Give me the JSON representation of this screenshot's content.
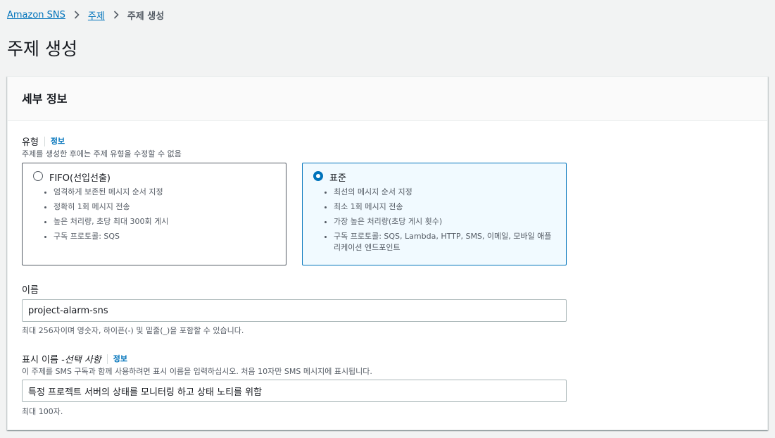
{
  "breadcrumb": {
    "items": [
      {
        "label": "Amazon SNS"
      },
      {
        "label": "주제"
      },
      {
        "label": "주제 생성"
      }
    ]
  },
  "page": {
    "title": "주제 생성"
  },
  "details_panel": {
    "title": "세부 정보",
    "type_field": {
      "label": "유형",
      "info": "정보",
      "description": "주제를 생성한 후에는 주제 유형을 수정할 수 없음",
      "options": [
        {
          "title": "FIFO(선입선출)",
          "selected": false,
          "features": [
            "엄격하게 보존된 메시지 순서 지정",
            "정확히 1회 메시지 전송",
            "높은 처리량, 초당 최대 300회 게시",
            "구독 프로토콜: SQS"
          ]
        },
        {
          "title": "표준",
          "selected": true,
          "features": [
            "최선의 메시지 순서 지정",
            "최소 1회 메시지 전송",
            "가장 높은 처리량(초당 게시 횟수)",
            "구독 프로토콜: SQS, Lambda, HTTP, SMS, 이메일, 모바일 애플리케이션 엔드포인트"
          ]
        }
      ]
    },
    "name_field": {
      "label": "이름",
      "value": "project-alarm-sns",
      "constraint": "최대 256자이며 영숫자, 하이픈(-) 및 밑줄(_)을 포함할 수 있습니다."
    },
    "display_name_field": {
      "label": "표시 이름 - ",
      "optional": "선택 사항",
      "info": "정보",
      "description": "이 주제를 SMS 구독과 함께 사용하려면 표시 이름을 입력하십시오. 처음 10자만 SMS 메시지에 표시됩니다.",
      "value": "특정 프로젝트 서버의 상태를 모니터링 하고 상태 노티를 위함",
      "constraint": "최대 100자."
    }
  },
  "colors": {
    "link": "#0073bb",
    "selected_border": "#0073bb",
    "selected_background": "#f1faff",
    "page_background": "#f2f3f3"
  }
}
